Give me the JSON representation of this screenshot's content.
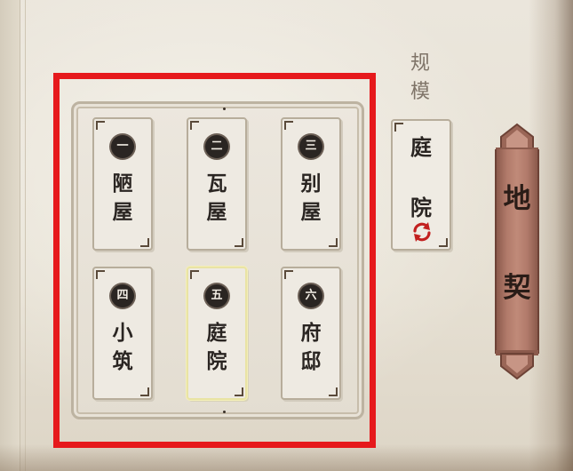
{
  "scale_options": [
    {
      "numeral": "一",
      "chars": [
        "陋",
        "屋"
      ],
      "selected": false
    },
    {
      "numeral": "二",
      "chars": [
        "瓦",
        "屋"
      ],
      "selected": false
    },
    {
      "numeral": "三",
      "chars": [
        "别",
        "屋"
      ],
      "selected": false
    },
    {
      "numeral": "四",
      "chars": [
        "小",
        "筑"
      ],
      "selected": false
    },
    {
      "numeral": "五",
      "chars": [
        "庭",
        "院"
      ],
      "selected": true
    },
    {
      "numeral": "六",
      "chars": [
        "府",
        "邸"
      ],
      "selected": false
    }
  ],
  "scale_label": [
    "规",
    "模"
  ],
  "current_scale": {
    "chars": [
      "庭",
      "院"
    ],
    "cycle_icon": "cycle-arrows-icon"
  },
  "deed_tab": {
    "chars": [
      "地",
      "契"
    ]
  },
  "colors": {
    "highlight": "#e6191c",
    "selected_border": "#e9e3a4",
    "cycle_icon": "#c2201f",
    "deed_tab": "#b17a6a"
  }
}
